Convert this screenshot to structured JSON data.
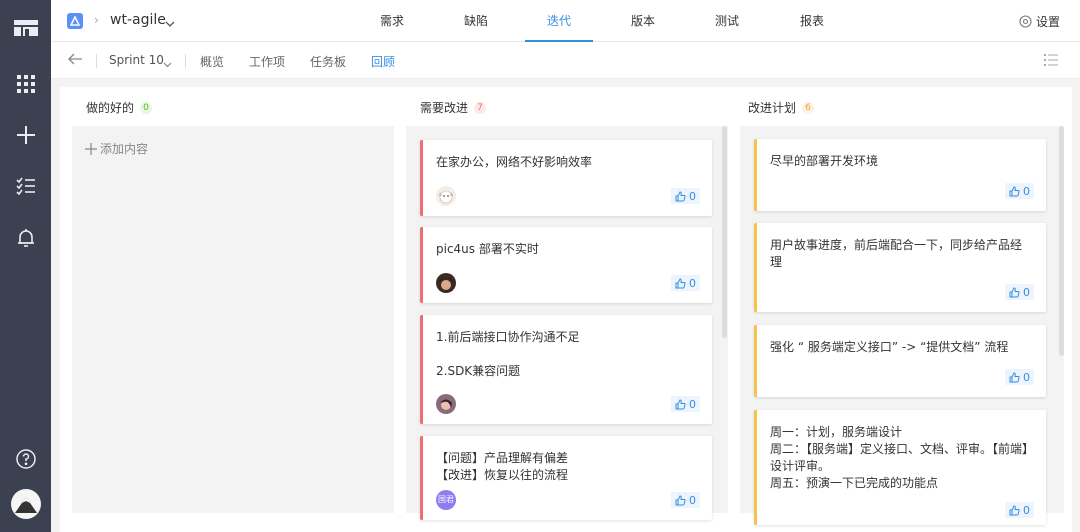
{
  "header": {
    "project_name": "wt-agile",
    "tabs": [
      {
        "label": "需求"
      },
      {
        "label": "缺陷"
      },
      {
        "label": "迭代"
      },
      {
        "label": "版本"
      },
      {
        "label": "测试"
      },
      {
        "label": "报表"
      }
    ],
    "active_tab": "迭代",
    "settings_label": "设置"
  },
  "subbar": {
    "sprint": "Sprint 10",
    "tabs": [
      {
        "label": "概览"
      },
      {
        "label": "工作项"
      },
      {
        "label": "任务板"
      },
      {
        "label": "回顾"
      }
    ],
    "active_tab": "回顾"
  },
  "rail": {
    "icons": [
      "logo-icon",
      "apps-grid-icon",
      "add-icon",
      "task-list-icon",
      "bell-icon",
      "help-icon",
      "user-avatar"
    ]
  },
  "columns": [
    {
      "title": "做的好的",
      "count": "0",
      "badge_color": "#52c41a",
      "badge_bg": "#e6f7e6",
      "add_label": "添加内容",
      "cards": []
    },
    {
      "title": "需要改进",
      "count": "7",
      "badge_color": "#f06e72",
      "badge_bg": "#fde8e8",
      "cards": [
        {
          "text": "在家办公，网络不好影响效率",
          "likes": "0",
          "avatar": "cat"
        },
        {
          "text": "pic4us 部署不实时",
          "likes": "0",
          "avatar": "person-a"
        },
        {
          "text": "1.前后端接口协作沟通不足\n\n2.SDK兼容问题",
          "likes": "0",
          "avatar": "person-b"
        },
        {
          "text": "【问题】产品理解有偏差\n【改进】恢复以往的流程",
          "likes": "0",
          "avatar": "国君"
        }
      ]
    },
    {
      "title": "改进计划",
      "count": "6",
      "badge_color": "#e6a23c",
      "badge_bg": "#fdf3e1",
      "cards": [
        {
          "text": "尽早的部署开发环境",
          "likes": "0"
        },
        {
          "text": "用户故事进度，前后端配合一下，同步给产品经理",
          "likes": "0"
        },
        {
          "text": "强化 “ 服务端定义接口” -> “提供文档” 流程",
          "likes": "0"
        },
        {
          "text": "周一：计划，服务端设计\n周二：【服务端】定义接口、文档、评审。【前端】设计评审。\n周五：预演一下已完成的功能点",
          "likes": "0"
        }
      ]
    }
  ],
  "colors": {
    "accent": "#348fe4",
    "rail_bg": "#3b4151",
    "need_improve_border": "#f06e72",
    "plan_border": "#f6c24c"
  }
}
